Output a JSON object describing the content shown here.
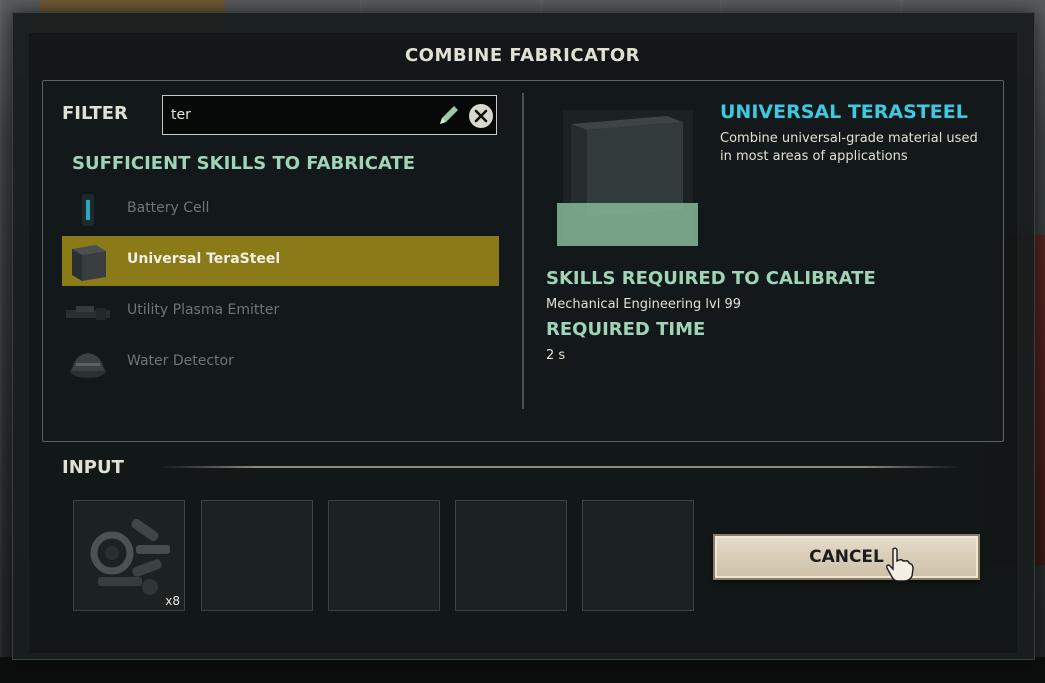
{
  "dialog": {
    "title": "COMBINE FABRICATOR"
  },
  "filter": {
    "label": "FILTER",
    "value": "ter"
  },
  "recipes": {
    "heading": "SUFFICIENT SKILLS TO FABRICATE",
    "items": [
      {
        "label": "Battery Cell",
        "icon": "battery-cell-icon",
        "selected": false
      },
      {
        "label": "Universal TeraSteel",
        "icon": "terasteel-cube-icon",
        "selected": true
      },
      {
        "label": "Utility Plasma Emitter",
        "icon": "plasma-emitter-icon",
        "selected": false
      },
      {
        "label": "Water Detector",
        "icon": "water-detector-icon",
        "selected": false
      }
    ]
  },
  "detail": {
    "title": "UNIVERSAL TERASTEEL",
    "description": "Combine universal-grade material used in most areas of applications",
    "skills_heading": "SKILLS REQUIRED TO CALIBRATE",
    "skills_value": "Mechanical Engineering lvl 99",
    "time_heading": "REQUIRED TIME",
    "time_value": "2 s"
  },
  "input": {
    "label": "INPUT",
    "slots": [
      {
        "item": "mechanical-parts-icon",
        "count": "x8"
      },
      {
        "item": null,
        "count": ""
      },
      {
        "item": null,
        "count": ""
      },
      {
        "item": null,
        "count": ""
      },
      {
        "item": null,
        "count": ""
      }
    ]
  },
  "actions": {
    "cancel_label": "CANCEL"
  },
  "colors": {
    "selected_row": "#8a7a18",
    "title_accent": "#3ec9e0",
    "heading_green": "#9fd4b8"
  }
}
